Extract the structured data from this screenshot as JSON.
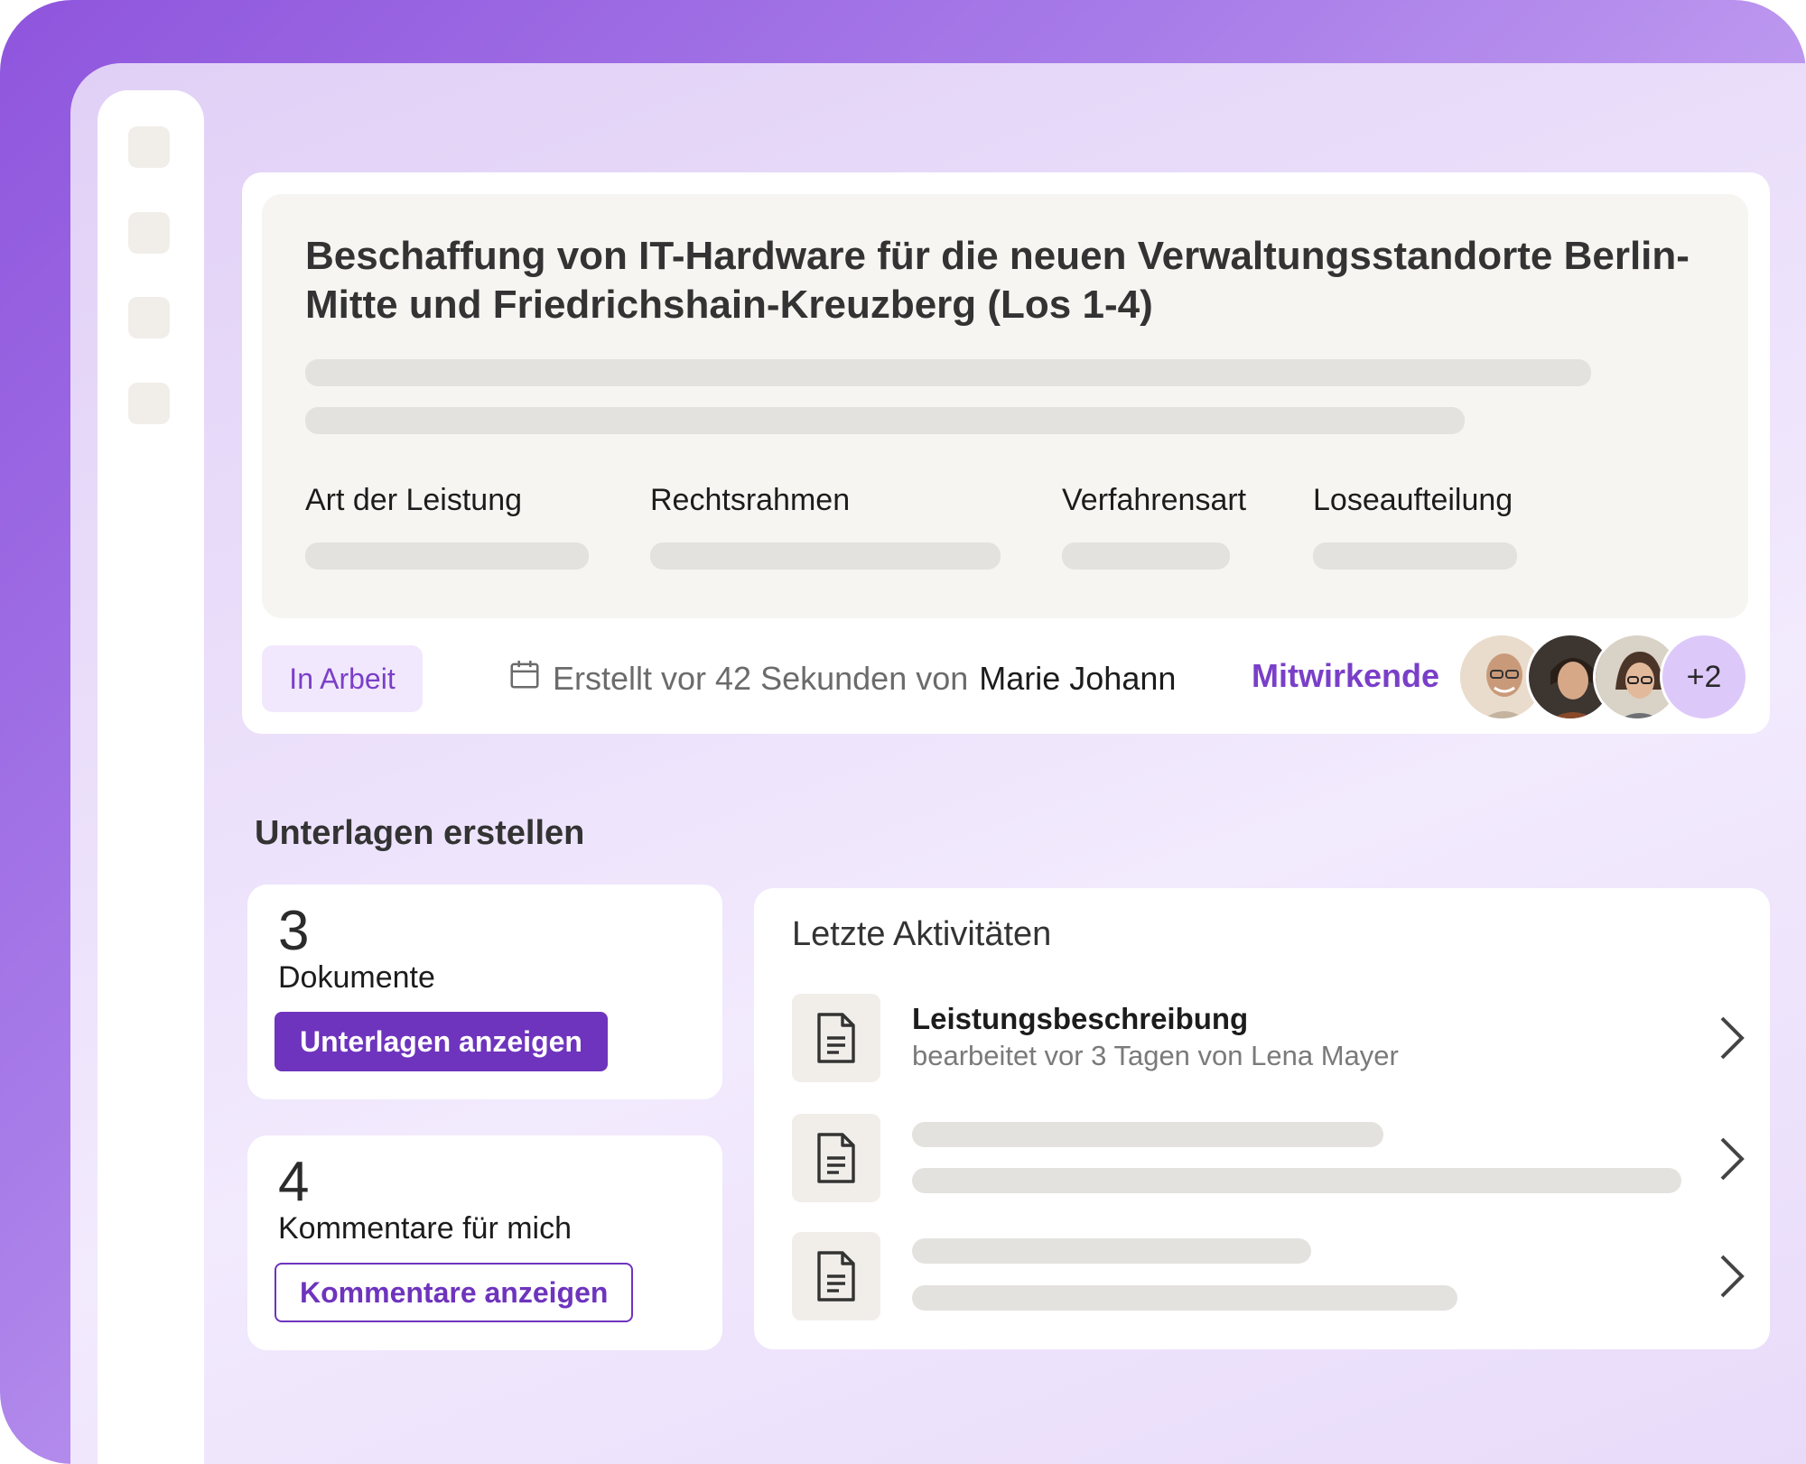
{
  "project": {
    "title": "Beschaffung von IT-Hardware für die neuen Verwaltungsstandorte Berlin-Mitte und Friedrichshain-Kreuzberg (Los 1-4)",
    "fields": [
      {
        "label": "Art der Leistung"
      },
      {
        "label": "Rechtsrahmen"
      },
      {
        "label": "Verfahrensart"
      },
      {
        "label": "Loseaufteilung"
      }
    ],
    "status": "In Arbeit",
    "created_prefix": "Erstellt vor 42 Sekunden von",
    "created_by": "Marie Johann",
    "contributors_label": "Mitwirkende",
    "contributors_more": "+2",
    "icons": {
      "calendar": "calendar-icon"
    }
  },
  "section": {
    "title": "Unterlagen erstellen"
  },
  "stats": {
    "documents": {
      "count": "3",
      "label": "Dokumente",
      "button": "Unterlagen anzeigen"
    },
    "comments": {
      "count": "4",
      "label": "Kommentare für mich",
      "button": "Kommentare anzeigen"
    }
  },
  "activities": {
    "title": "Letzte Aktivitäten",
    "items": [
      {
        "name": "Leistungsbeschreibung",
        "detail": "bearbeitet vor 3 Tagen von Lena Mayer",
        "icon": "document-icon"
      }
    ]
  },
  "colors": {
    "accent": "#6e34bd",
    "badge_bg": "#f1e8fd",
    "skeleton": "#e4e2de"
  }
}
